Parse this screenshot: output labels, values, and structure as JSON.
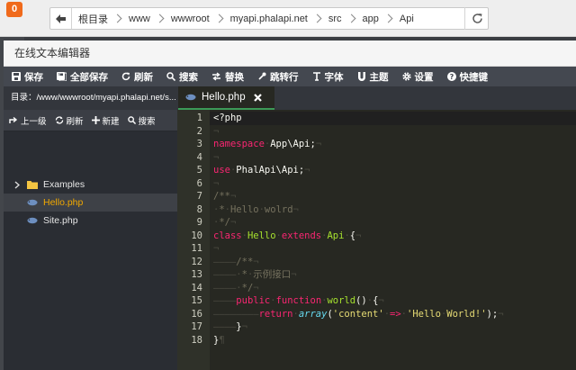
{
  "browser": {
    "badge": "0",
    "breadcrumbs": [
      "根目录",
      "www",
      "wwwroot",
      "myapi.phalapi.net",
      "src",
      "app",
      "Api"
    ]
  },
  "window": {
    "title": "在线文本编辑器"
  },
  "toolbar": [
    {
      "label": "保存",
      "icon": "save-icon"
    },
    {
      "label": "全部保存",
      "icon": "save-all-icon"
    },
    {
      "label": "刷新",
      "icon": "refresh-icon"
    },
    {
      "label": "搜索",
      "icon": "search-icon"
    },
    {
      "label": "替换",
      "icon": "replace-icon"
    },
    {
      "label": "跳转行",
      "icon": "goto-line-icon"
    },
    {
      "label": "字体",
      "icon": "font-icon"
    },
    {
      "label": "主题",
      "icon": "theme-icon"
    },
    {
      "label": "设置",
      "icon": "gear-icon"
    },
    {
      "label": "快捷键",
      "icon": "help-icon"
    }
  ],
  "sidebar": {
    "path_label": "目录：",
    "path": "/www/wwwroot/myapi.phalapi.net/s...",
    "actions": [
      {
        "label": "上一级",
        "icon": "up-level-icon"
      },
      {
        "label": "刷新",
        "icon": "refresh-icon"
      },
      {
        "label": "新建",
        "icon": "plus-icon"
      },
      {
        "label": "搜索",
        "icon": "search-icon"
      }
    ],
    "tree": [
      {
        "name": "Examples",
        "type": "folder",
        "selected": false
      },
      {
        "name": "Hello.php",
        "type": "file",
        "selected": true
      },
      {
        "name": "Site.php",
        "type": "file",
        "selected": false
      }
    ]
  },
  "tabs": [
    {
      "label": "Hello.php",
      "active": true
    }
  ],
  "editor": {
    "line_numbers": [
      "1",
      "2",
      "3",
      "4",
      "5",
      "6",
      "7",
      "8",
      "9",
      "10",
      "11",
      "12",
      "13",
      "14",
      "15",
      "16",
      "17",
      "18"
    ],
    "current_line": "1"
  },
  "colors": {
    "keyword": "#f92672",
    "function": "#a6e22e",
    "string": "#e6db74",
    "comment": "#75715e",
    "tab_active_border": "#3c9a57",
    "badge": "#f06a1b"
  }
}
